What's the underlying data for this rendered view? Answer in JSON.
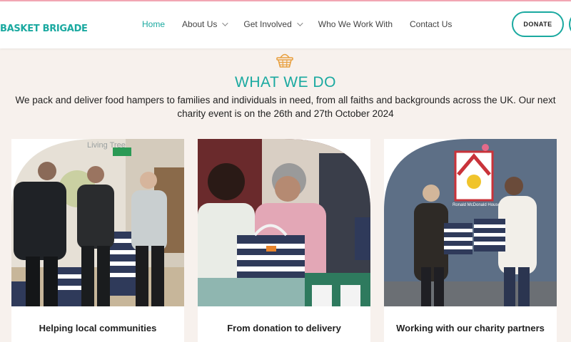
{
  "header": {
    "logo": "BASKET BRIGADE",
    "nav": [
      {
        "label": "Home",
        "active": true,
        "dropdown": false
      },
      {
        "label": "About Us",
        "active": false,
        "dropdown": true
      },
      {
        "label": "Get Involved",
        "active": false,
        "dropdown": true
      },
      {
        "label": "Who We Work With",
        "active": false,
        "dropdown": false
      },
      {
        "label": "Contact Us",
        "active": false,
        "dropdown": false
      }
    ],
    "donate_label": "DONATE"
  },
  "section": {
    "icon": "basket-icon",
    "heading": "WHAT WE DO",
    "intro": "We pack and deliver food hampers to families and individuals in need, from all faiths and backgrounds across the UK. Our next charity event is on the 26th and 27th October 2024"
  },
  "cards": [
    {
      "title": "Helping local communities",
      "photo_text": "Living Tree"
    },
    {
      "title": "From donation to delivery",
      "photo_text": ""
    },
    {
      "title": "Working with our charity partners",
      "photo_text": "Ronald McDonald House Charities"
    }
  ],
  "colors": {
    "accent": "#1aa9a0",
    "background": "#f7f1ed",
    "basket_icon": "#e8a040"
  }
}
